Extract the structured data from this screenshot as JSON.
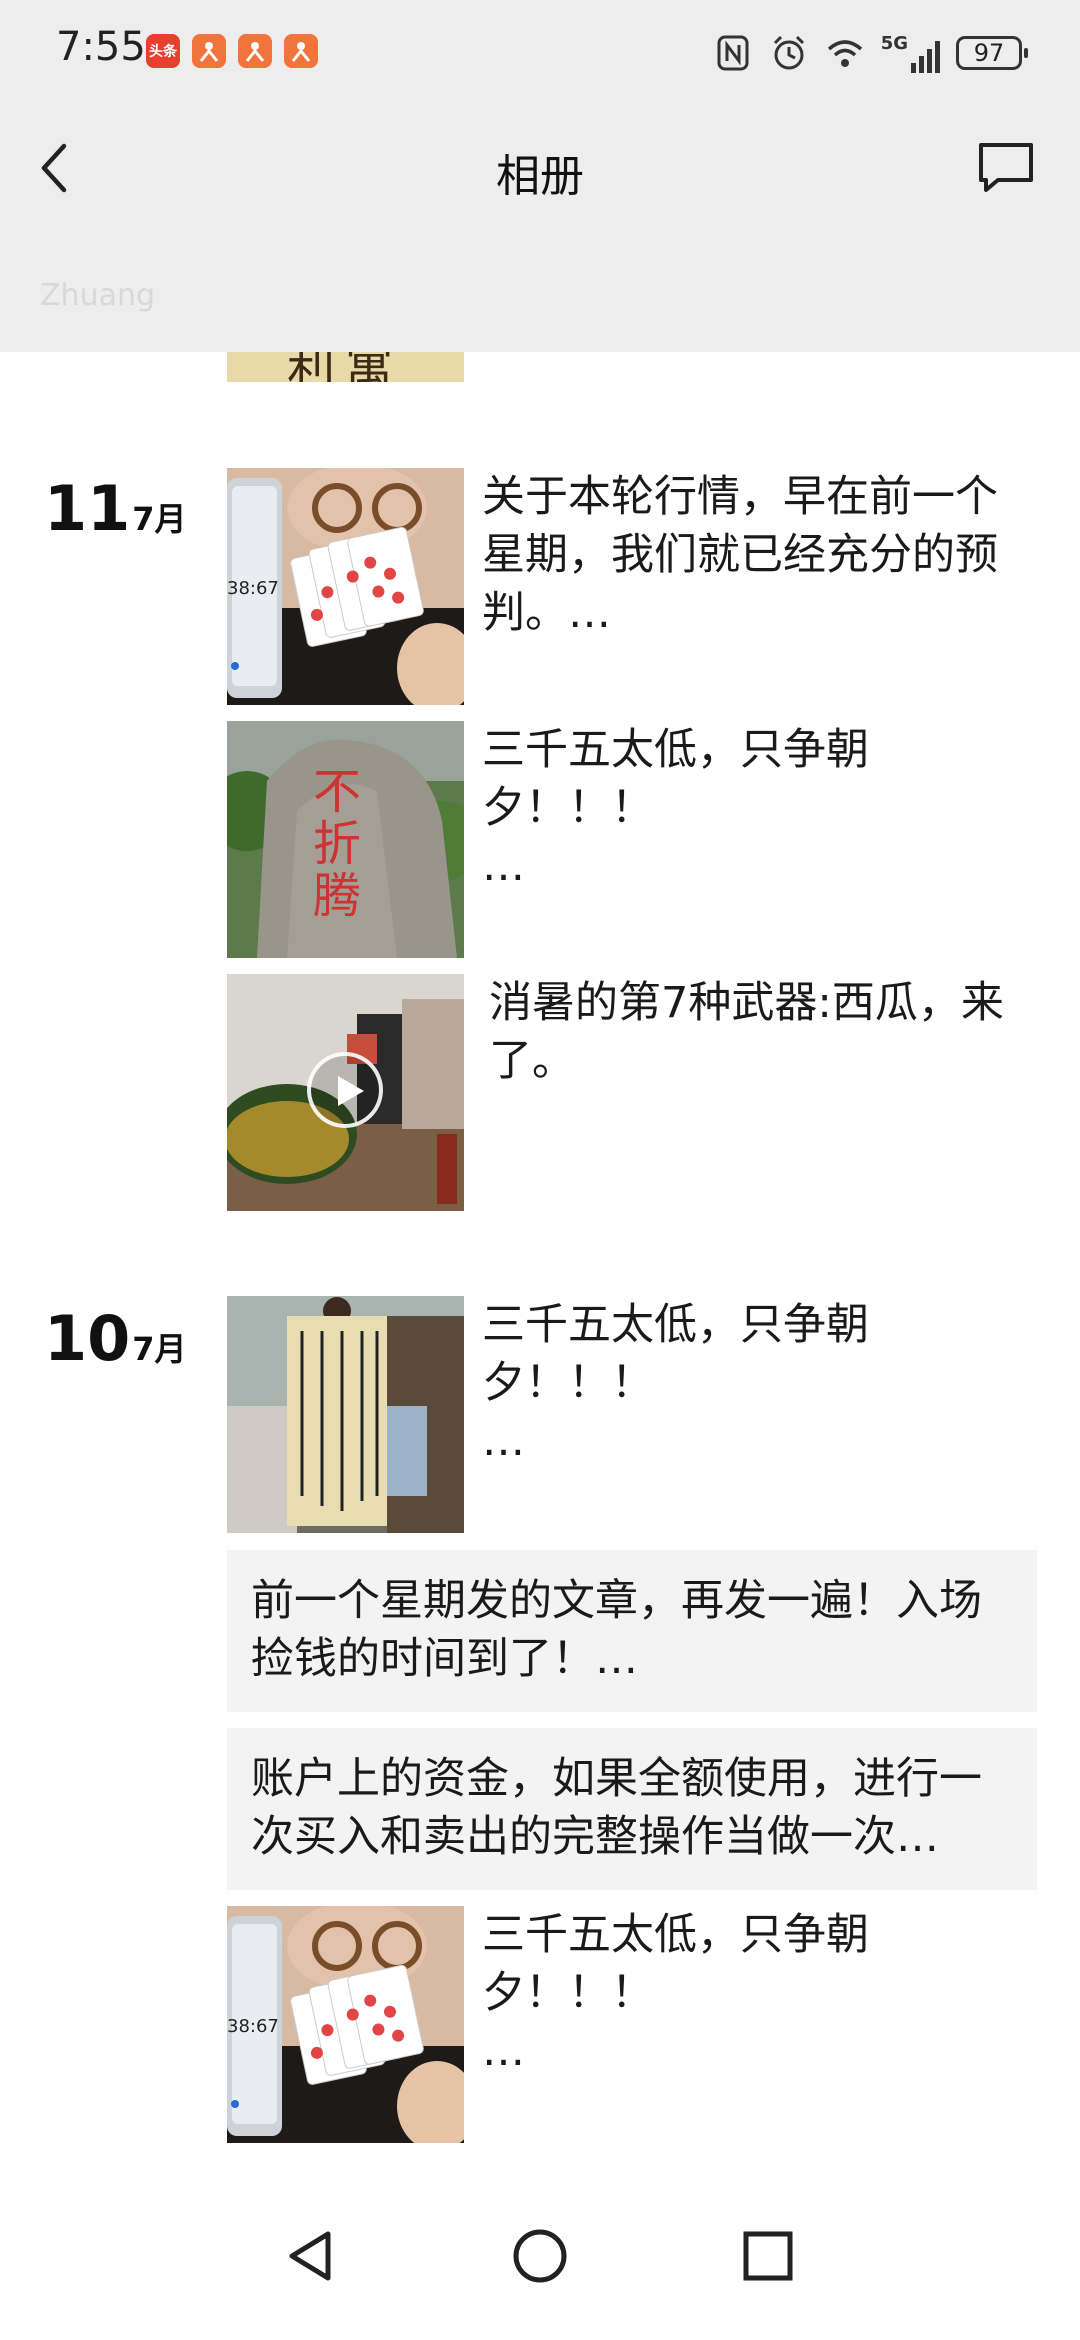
{
  "status_bar": {
    "time": "7:55",
    "app_icons": [
      {
        "name": "toutiao-icon",
        "label": "头条",
        "color": "#e8402f"
      },
      {
        "name": "app-icon-1",
        "label": "",
        "color": "#f0743b"
      },
      {
        "name": "app-icon-2",
        "label": "",
        "color": "#f0743b"
      },
      {
        "name": "app-icon-3",
        "label": "",
        "color": "#f0743b"
      }
    ],
    "network": "5G",
    "battery": "97"
  },
  "nav": {
    "title": "相册",
    "subtitle": "Zhuang"
  },
  "top_partial": "利寓",
  "days": [
    {
      "day": "11",
      "month": "7月"
    },
    {
      "day": "10",
      "month": "7月"
    }
  ],
  "posts": [
    {
      "text": "关于本轮行情，早在前一个星期，我们就已经充分的预判。…",
      "thumb": "cards"
    },
    {
      "text": "三千五太低，只争朝\n夕！！！\n…",
      "thumb": "stone",
      "stone_chars": "不折腾"
    },
    {
      "text": "消暑的第7种武器:西瓜，来了。",
      "thumb": "video-watermelon"
    },
    {
      "text": "三千五太低，只争朝\n夕！！！\n…",
      "thumb": "calligraphy"
    },
    {
      "text": "前一个星期发的文章，再发一遍！入场捡钱的时间到了！…"
    },
    {
      "text": "账户上的资金，如果全额使用，进行一次买入和卖出的完整操作当做一次…"
    },
    {
      "text": "三千五太低，只争朝\n夕！！！\n…",
      "thumb": "cards"
    }
  ],
  "thumb_text": {
    "phone_time": "38:67"
  },
  "colors": {
    "background": "#ffffff",
    "header": "#ededed",
    "card": "#f3f3f3"
  }
}
